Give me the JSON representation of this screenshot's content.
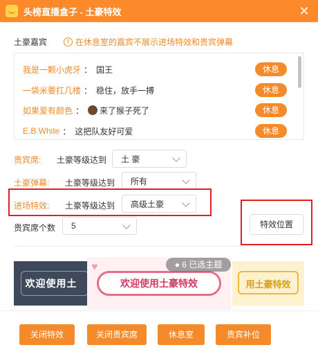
{
  "window": {
    "title": "头榜直播盒子 - 土豪特效"
  },
  "guests_section": {
    "label": "土豪嘉宾",
    "hint": "在休息室的嘉宾不展示进场特效和贵宾弹幕",
    "rows": [
      {
        "name": "我是一颗小虎牙",
        "message": "国王",
        "action": "休息"
      },
      {
        "name": "一袋米要扛几楼",
        "message": "稳住，放手一搏",
        "action": "休息"
      },
      {
        "name": "如果爱有颜色",
        "message": "来了猴子死了",
        "action": "休息"
      },
      {
        "name": "E.B.White",
        "message": "这把队友好可爱",
        "action": "休息"
      }
    ]
  },
  "settings": {
    "vip_seat": {
      "label": "贵宾席:",
      "sub": "土豪等级达到",
      "value": "土 豪"
    },
    "danmaku": {
      "label": "土豪弹幕:",
      "sub": "土豪等级达到",
      "value": "所有"
    },
    "entry_effect": {
      "label": "进场特效:",
      "sub": "土豪等级达到",
      "value": "高级土豪"
    },
    "seat_count": {
      "label": "贵宾席个数",
      "value": "5"
    },
    "effect_position_button": "特效位置"
  },
  "themes": {
    "dark_text": "欢迎使用土",
    "pink_text": "欢迎使用土豪特效",
    "gold_text": "用土豪特效",
    "selected_badge": "6 已选主题"
  },
  "actions": {
    "close_effect": "关闭特效",
    "close_vip": "关闭贵宾席",
    "lounge": "休息室",
    "vip_fill": "贵宾补位"
  },
  "colors": {
    "accent": "#f58a2b",
    "highlight_box": "#e02020"
  }
}
